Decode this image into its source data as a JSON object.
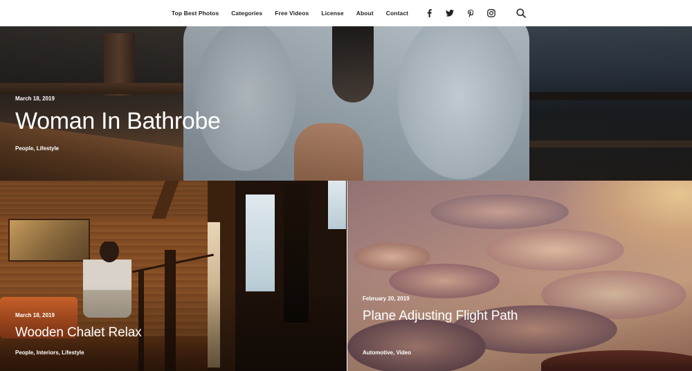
{
  "nav": {
    "links": [
      "Top Best Photos",
      "Categories",
      "Free Videos",
      "License",
      "About",
      "Contact"
    ],
    "social": [
      {
        "icon": "facebook-icon"
      },
      {
        "icon": "twitter-icon"
      },
      {
        "icon": "pinterest-icon"
      },
      {
        "icon": "instagram-icon"
      }
    ],
    "search_icon": "search-icon"
  },
  "hero": {
    "date": "March 18, 2019",
    "title": "Woman In Bathrobe",
    "categories": "People, Lifestyle"
  },
  "cards": [
    {
      "date": "March 18, 2019",
      "title": "Wooden Chalet Relax",
      "categories": "People, Interiors, Lifestyle"
    },
    {
      "date": "February 20, 2019",
      "title": "Plane Adjusting Flight Path",
      "categories": "Automotive, Video"
    }
  ],
  "colors": {
    "nav_bg": "#ffffff",
    "nav_text": "#222222",
    "overlay_text": "#ffffff"
  }
}
